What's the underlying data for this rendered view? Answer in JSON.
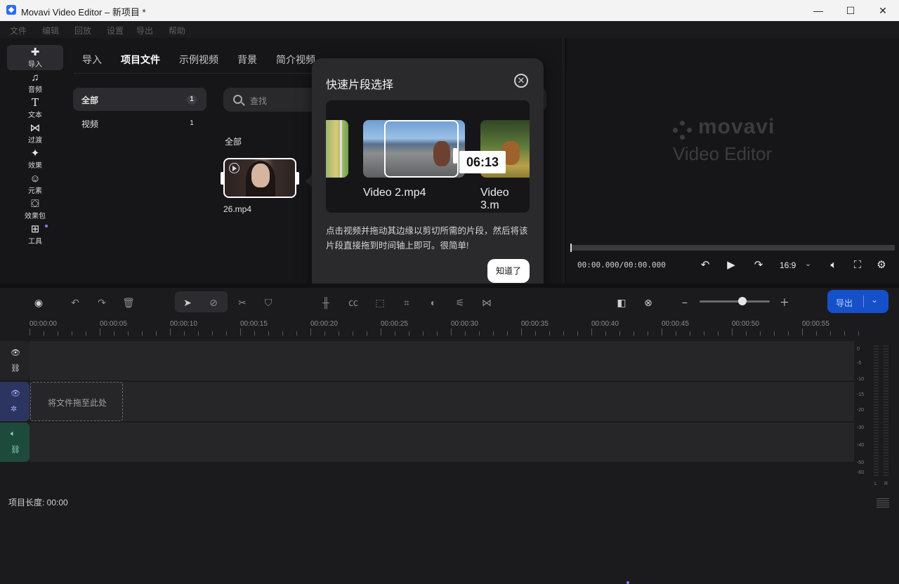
{
  "window": {
    "title": "Movavi Video Editor – 新项目 *",
    "minimize": "—",
    "maximize": "☐",
    "close": "✕"
  },
  "menu": [
    "文件",
    "编辑",
    "回放",
    "设置",
    "导出",
    "帮助"
  ],
  "sidebar": [
    {
      "label": "导入",
      "icon": "plus-icon",
      "active": true
    },
    {
      "label": "音频",
      "icon": "music-note-icon"
    },
    {
      "label": "文本",
      "icon": "text-icon"
    },
    {
      "label": "过渡",
      "icon": "transition-icon"
    },
    {
      "label": "效果",
      "icon": "sparkle-icon"
    },
    {
      "label": "元素",
      "icon": "smiley-icon"
    },
    {
      "label": "效果包",
      "icon": "store-icon"
    },
    {
      "label": "工具",
      "icon": "grid-icon"
    }
  ],
  "media": {
    "tabs": [
      "导入",
      "项目文件",
      "示例视频",
      "背景",
      "简介视频"
    ],
    "active_tab": 1,
    "categories": [
      {
        "label": "全部",
        "count": "1"
      },
      {
        "label": "视频",
        "count": "1"
      }
    ],
    "search_placeholder": "查找",
    "section_label": "全部",
    "clip_name": "26.mp4"
  },
  "popup": {
    "title": "快速片段选择",
    "demo_label_1": "Video 2.mp4",
    "demo_label_2": "Video 3.m",
    "demo_duration": "06:13",
    "text": "点击视频并拖动其边缘以剪切所需的片段，然后将该片段直接拖到时间轴上即可。很简单!",
    "ok": "知道了"
  },
  "preview": {
    "logo_word": "movavi",
    "logo_sub": "Video Editor",
    "timecode": "00:00.000/00:00.000",
    "ratio": "16:9"
  },
  "toolbar": {
    "export_label": "导出"
  },
  "ruler": [
    "00:00:00",
    "00:00:05",
    "00:00:10",
    "00:00:15",
    "00:00:20",
    "00:00:25",
    "00:00:30",
    "00:00:35",
    "00:00:40",
    "00:00:45",
    "00:00:50",
    "00:00:55"
  ],
  "tracks": {
    "drop_label": "将文件拖至此处"
  },
  "vu": {
    "scale": [
      "0",
      "-5",
      "-10",
      "-15",
      "-20",
      "-30",
      "-40",
      "-50",
      "-60"
    ],
    "left": "L",
    "right": "R"
  },
  "status": {
    "text": "项目长度: 00:00"
  },
  "colors": {
    "accent": "#1650c8",
    "video_track": "#2b3560",
    "audio_track": "#1e4a3c"
  }
}
